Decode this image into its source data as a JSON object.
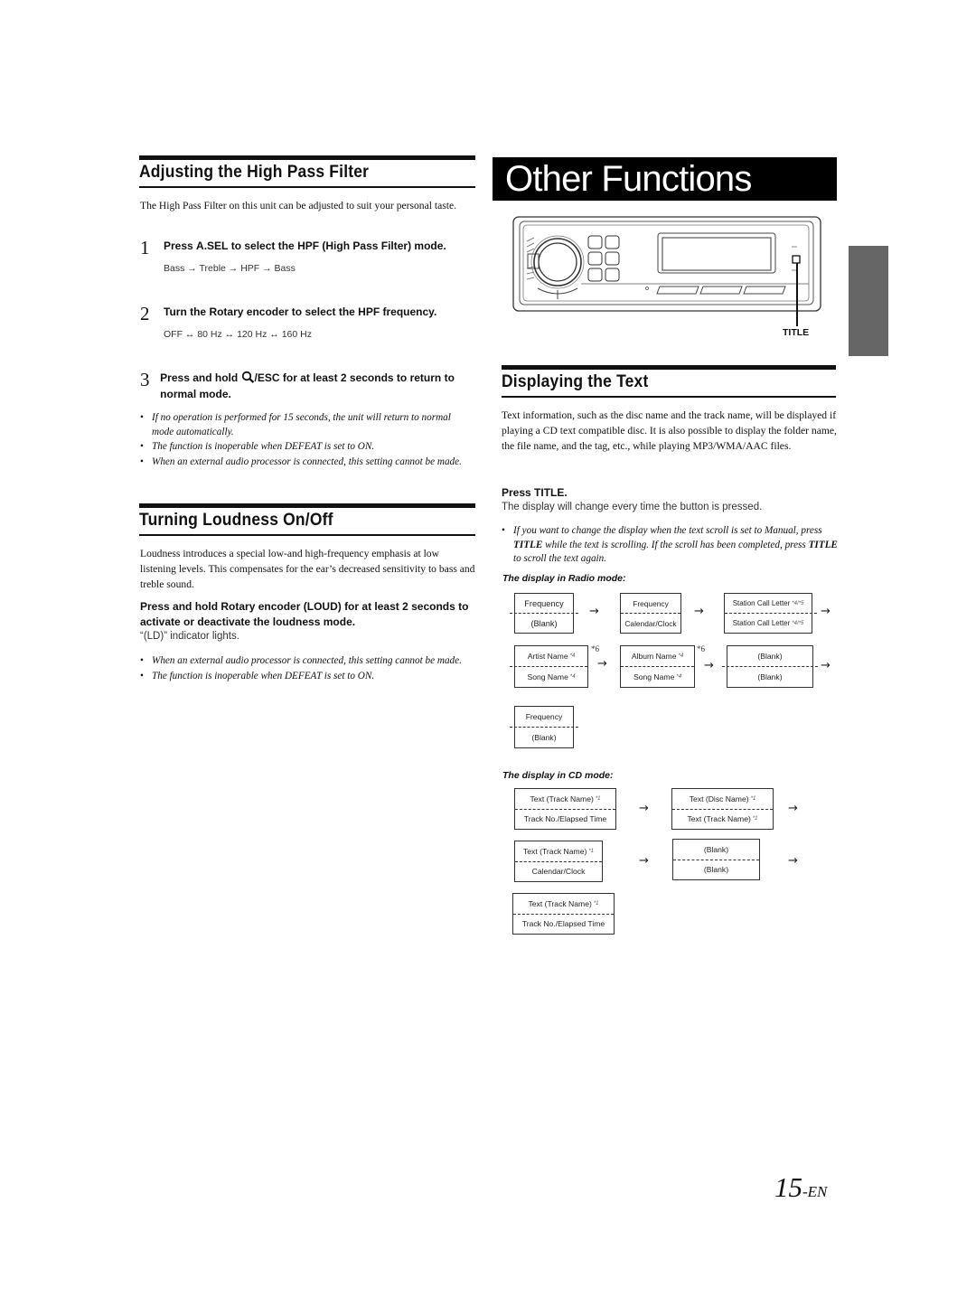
{
  "left_column": {
    "hpf": {
      "heading": "Adjusting the High Pass Filter",
      "intro": "The High Pass Filter on this unit can be adjusted to suit your personal taste.",
      "steps": [
        {
          "num": "1",
          "pre": "Press ",
          "key": "A.SEL",
          "post": " to select the HPF (High Pass Filter) mode.",
          "sequence": "Bass → Treble → HPF → Bass"
        },
        {
          "num": "2",
          "pre": "Turn the ",
          "key": "Rotary encoder",
          "post": " to select the HPF frequency.",
          "sequence": "OFF ↔ 80 Hz ↔ 120 Hz ↔ 160 Hz"
        },
        {
          "num": "3",
          "pre": "Press and hold ",
          "icon": "search-icon",
          "key": "/ESC",
          "post": " for at least 2 seconds to return to normal mode."
        }
      ],
      "notes": [
        "If no operation is performed for 15 seconds, the unit will return to normal mode automatically.",
        "The function is inoperable when DEFEAT is set to ON.",
        "When an external audio processor is connected, this setting cannot be made."
      ]
    },
    "loudness": {
      "heading": "Turning Loudness On/Off",
      "intro": "Loudness introduces a special low-and high-frequency emphasis at low listening levels. This compensates for the ear’s decreased sensitivity to bass and treble sound.",
      "instruction_pre": "Press and hold ",
      "instruction_key": "Rotary encoder",
      "instruction_mid": " (",
      "instruction_key2": "LOUD",
      "instruction_post": ") for at least 2 seconds to activate or deactivate the loudness mode.",
      "result": "“(LD)” indicator lights.",
      "notes": [
        "When an external audio processor is connected, this setting cannot be made.",
        "The function is inoperable when DEFEAT is set to ON."
      ]
    }
  },
  "right_column": {
    "banner_title": "Other Functions",
    "device_label": "TITLE",
    "display_text": {
      "heading": "Displaying the Text",
      "intro": "Text information, such as the disc name and the track name, will be displayed if playing a CD text compatible disc. It is also possible to display the folder name, the file name, and the tag, etc., while playing MP3/WMA/AAC files.",
      "instruction_pre": "Press ",
      "instruction_key": "TITLE",
      "instruction_post": ".",
      "result": "The display will change every time the button is pressed.",
      "note_parts": [
        "If you want to change the display when the text scroll is set to Manual, press ",
        "TITLE",
        " while the text is scrolling. If the scroll has been completed, press ",
        "TITLE",
        " to scroll the text again."
      ]
    },
    "radio_mode": {
      "caption": "The display in Radio mode:",
      "boxes": [
        {
          "top": "Frequency",
          "bottom": "(Blank)"
        },
        {
          "top": "Frequency",
          "bottom": "Calendar/Clock"
        },
        {
          "top": "Station Call Letter",
          "top_note": "*4/*5",
          "bottom": "Station Call Letter",
          "bottom_note": "*4/*5"
        },
        {
          "top": "Artist Name",
          "top_note": "*4",
          "bottom": "Song Name",
          "bottom_note": "*4",
          "side_note": "*6"
        },
        {
          "top": "Album Name",
          "top_note": "*4",
          "bottom": "Song Name",
          "bottom_note": "*4",
          "side_note": "*6"
        },
        {
          "top": "(Blank)",
          "bottom": "(Blank)"
        },
        {
          "top": "Frequency",
          "bottom": "(Blank)"
        }
      ],
      "arrow": "→"
    },
    "cd_mode": {
      "caption": "The display in CD mode:",
      "boxes": [
        {
          "top": "Text (Track Name)",
          "top_note": "*1",
          "bottom": "Track No./Elapsed Time"
        },
        {
          "top": "Text (Disc Name)",
          "top_note": "*1",
          "bottom": "Text (Track Name)",
          "bottom_note": "*1"
        },
        {
          "top": "Text (Track Name)",
          "top_note": "*1",
          "bottom": "Calendar/Clock"
        },
        {
          "top": "(Blank)",
          "bottom": "(Blank)"
        },
        {
          "top": "Text (Track Name)",
          "top_note": "*1",
          "bottom": "Track No./Elapsed Time"
        }
      ],
      "arrow": "→"
    }
  },
  "page_number": {
    "num": "15",
    "suffix": "-EN"
  }
}
